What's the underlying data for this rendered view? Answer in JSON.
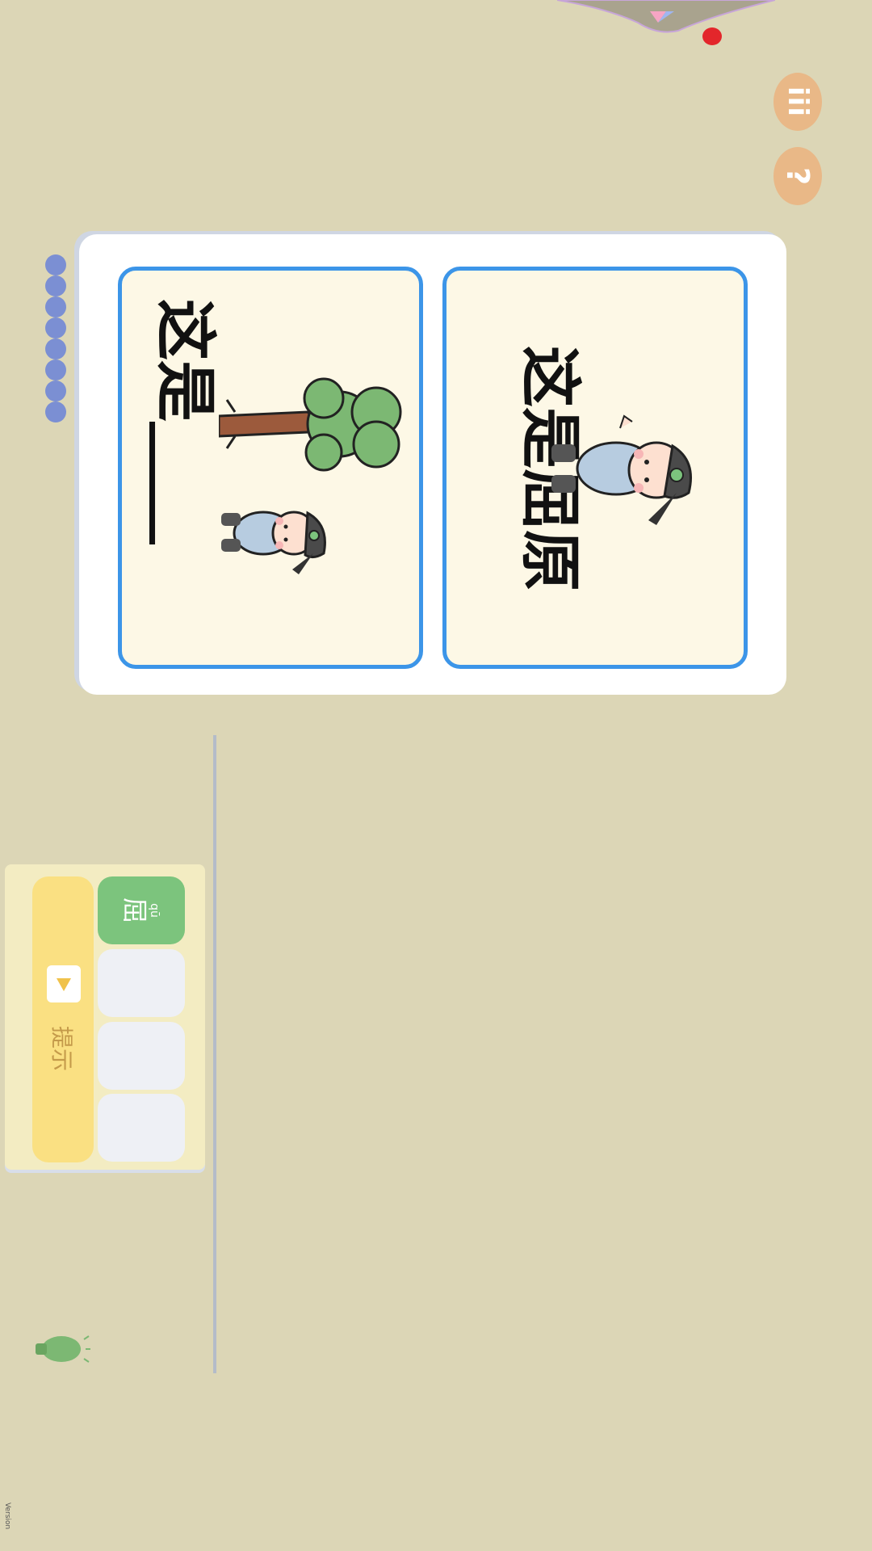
{
  "header": {
    "menu_icon_label": "iii",
    "help_icon_label": "?"
  },
  "cards": {
    "right": {
      "text": "这是屈原"
    },
    "left": {
      "text": "这是____"
    }
  },
  "answer": {
    "hint_label": "提示",
    "slots": [
      {
        "pinyin": "qū",
        "char": "屈",
        "filled": true
      },
      {
        "filled": false
      },
      {
        "filled": false
      },
      {
        "filled": false
      }
    ]
  },
  "progress": {
    "beads": 8
  },
  "footer": {
    "version": "Version"
  },
  "colors": {
    "background": "#dcd6b6",
    "card_border": "#3c95e8",
    "slot_filled": "#7cc47d",
    "hint_bg": "#fae082",
    "button": "#e9b887",
    "bead": "#7b8fd3"
  }
}
